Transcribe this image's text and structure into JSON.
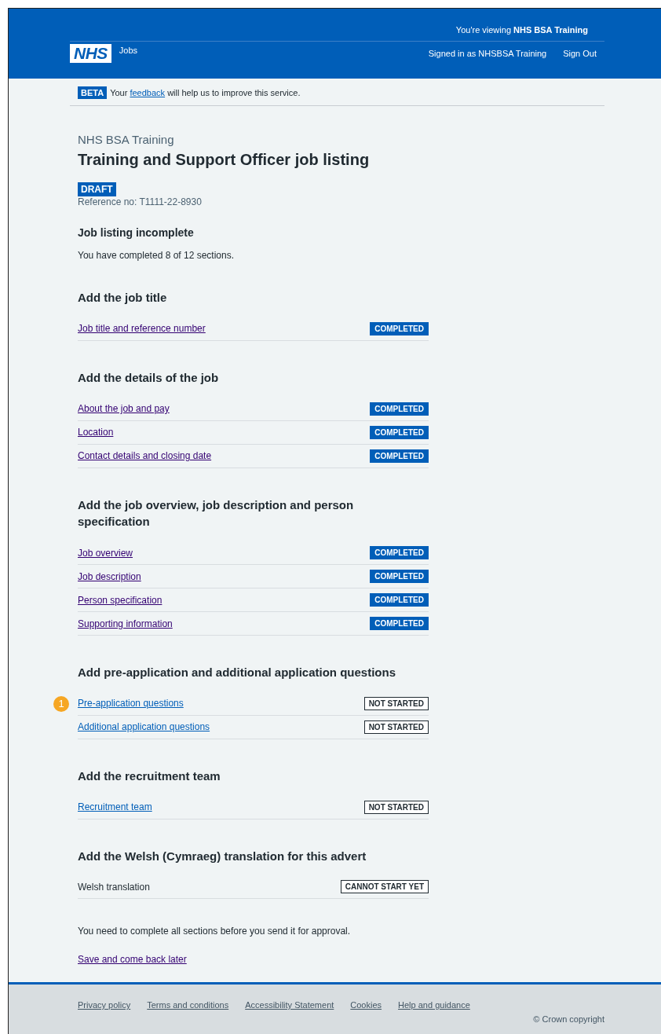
{
  "header": {
    "logo": "NHS",
    "service": "Jobs",
    "viewing_prefix": "You're viewing ",
    "viewing_org": "NHS BSA Training",
    "signed_in": "Signed in as NHSBSA Training",
    "sign_out": "Sign Out"
  },
  "beta": {
    "tag": "BETA",
    "text_before": "Your ",
    "link": "feedback",
    "text_after": " will help us to improve this service."
  },
  "caption": "NHS BSA Training",
  "title": "Training and Support Officer job listing",
  "draft_tag": "DRAFT",
  "reference": "Reference no: T1111-22-8930",
  "summary": {
    "heading": "Job listing incomplete",
    "text": "You have completed 8 of 12 sections."
  },
  "sections": [
    {
      "heading": "Add the job title",
      "rows": [
        {
          "label": "Job title and reference number",
          "kind": "link",
          "visited": true,
          "status": {
            "text": "COMPLETED",
            "kind": "completed"
          }
        }
      ]
    },
    {
      "heading": "Add the details of the job",
      "rows": [
        {
          "label": "About the job and pay",
          "kind": "link",
          "visited": true,
          "status": {
            "text": "COMPLETED",
            "kind": "completed"
          }
        },
        {
          "label": "Location",
          "kind": "link",
          "visited": true,
          "status": {
            "text": "COMPLETED",
            "kind": "completed"
          }
        },
        {
          "label": "Contact details and closing date",
          "kind": "link",
          "visited": true,
          "status": {
            "text": "COMPLETED",
            "kind": "completed"
          }
        }
      ]
    },
    {
      "heading": "Add the job overview, job description and person specification",
      "rows": [
        {
          "label": "Job overview",
          "kind": "link",
          "visited": true,
          "status": {
            "text": "COMPLETED",
            "kind": "completed"
          }
        },
        {
          "label": "Job description",
          "kind": "link",
          "visited": true,
          "status": {
            "text": "COMPLETED",
            "kind": "completed"
          }
        },
        {
          "label": "Person specification",
          "kind": "link",
          "visited": true,
          "status": {
            "text": "COMPLETED",
            "kind": "completed"
          }
        },
        {
          "label": "Supporting information",
          "kind": "link",
          "visited": true,
          "status": {
            "text": "COMPLETED",
            "kind": "completed"
          }
        }
      ]
    },
    {
      "heading": "Add pre-application and additional application questions",
      "rows": [
        {
          "label": "Pre-application questions",
          "kind": "link",
          "visited": false,
          "status": {
            "text": "NOT STARTED",
            "kind": "outline"
          },
          "callout": "1"
        },
        {
          "label": "Additional application questions",
          "kind": "link",
          "visited": false,
          "status": {
            "text": "NOT STARTED",
            "kind": "outline"
          }
        }
      ]
    },
    {
      "heading": "Add the recruitment team",
      "rows": [
        {
          "label": "Recruitment team",
          "kind": "link",
          "visited": false,
          "status": {
            "text": "NOT STARTED",
            "kind": "outline"
          }
        }
      ]
    },
    {
      "heading": "Add the Welsh (Cymraeg) translation for this advert",
      "rows": [
        {
          "label": "Welsh translation",
          "kind": "text",
          "status": {
            "text": "CANNOT START YET",
            "kind": "outline"
          }
        }
      ]
    }
  ],
  "note": "You need to complete all sections before you send it for approval.",
  "save_link": "Save and come back later",
  "footer": {
    "links": [
      "Privacy policy",
      "Terms and conditions",
      "Accessibility Statement",
      "Cookies",
      "Help and guidance"
    ],
    "copyright": "© Crown copyright"
  }
}
